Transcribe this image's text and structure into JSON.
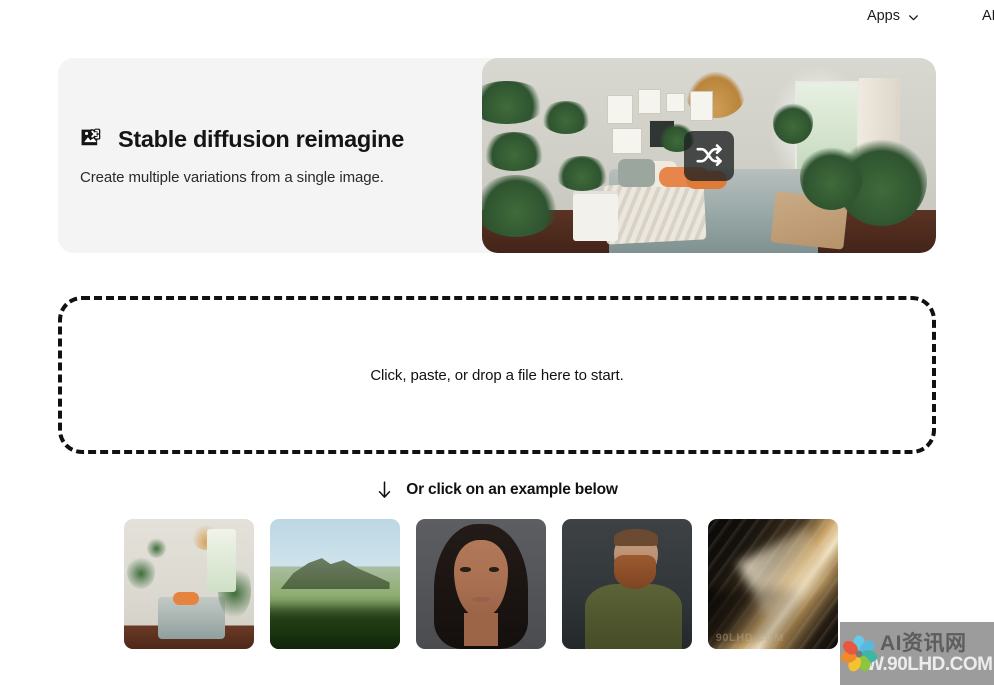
{
  "header": {
    "nav": [
      {
        "label": "Apps",
        "icon": "chevron-down-icon"
      },
      {
        "label": "API",
        "icon": null
      }
    ]
  },
  "hero": {
    "icon": "image-shuffle-icon",
    "title": "Stable diffusion reimagine",
    "subtitle": "Create multiple variations from a single image.",
    "image_alt": "Bedroom filled with houseplants",
    "badge_icon": "shuffle-icon",
    "background_color": "#f4f4f4"
  },
  "dropzone": {
    "text": "Click, paste, or drop a file here to start.",
    "border_color": "#111111",
    "border_style": "dashed"
  },
  "examples_hint": {
    "arrow_icon": "arrow-down-icon",
    "text": "Or click on an example below"
  },
  "examples": [
    {
      "name": "example-bedroom",
      "alt": "Bedroom with plants and orange pillows"
    },
    {
      "name": "example-mountain",
      "alt": "Green mountain ridge under blue sky"
    },
    {
      "name": "example-woman-portrait",
      "alt": "Portrait of a smiling woman with long dark hair"
    },
    {
      "name": "example-bearded-man",
      "alt": "Portrait of a bearded man in a green shirt"
    },
    {
      "name": "example-abstract-blur",
      "alt": "Abstract golden motion-blurred texture",
      "overlay_text": "90LHD.COM"
    }
  ],
  "watermark": {
    "logo": "flower-logo-icon",
    "line1": "AI资讯网",
    "line2": "W.90LHD.COM",
    "background_color": "#808080"
  }
}
